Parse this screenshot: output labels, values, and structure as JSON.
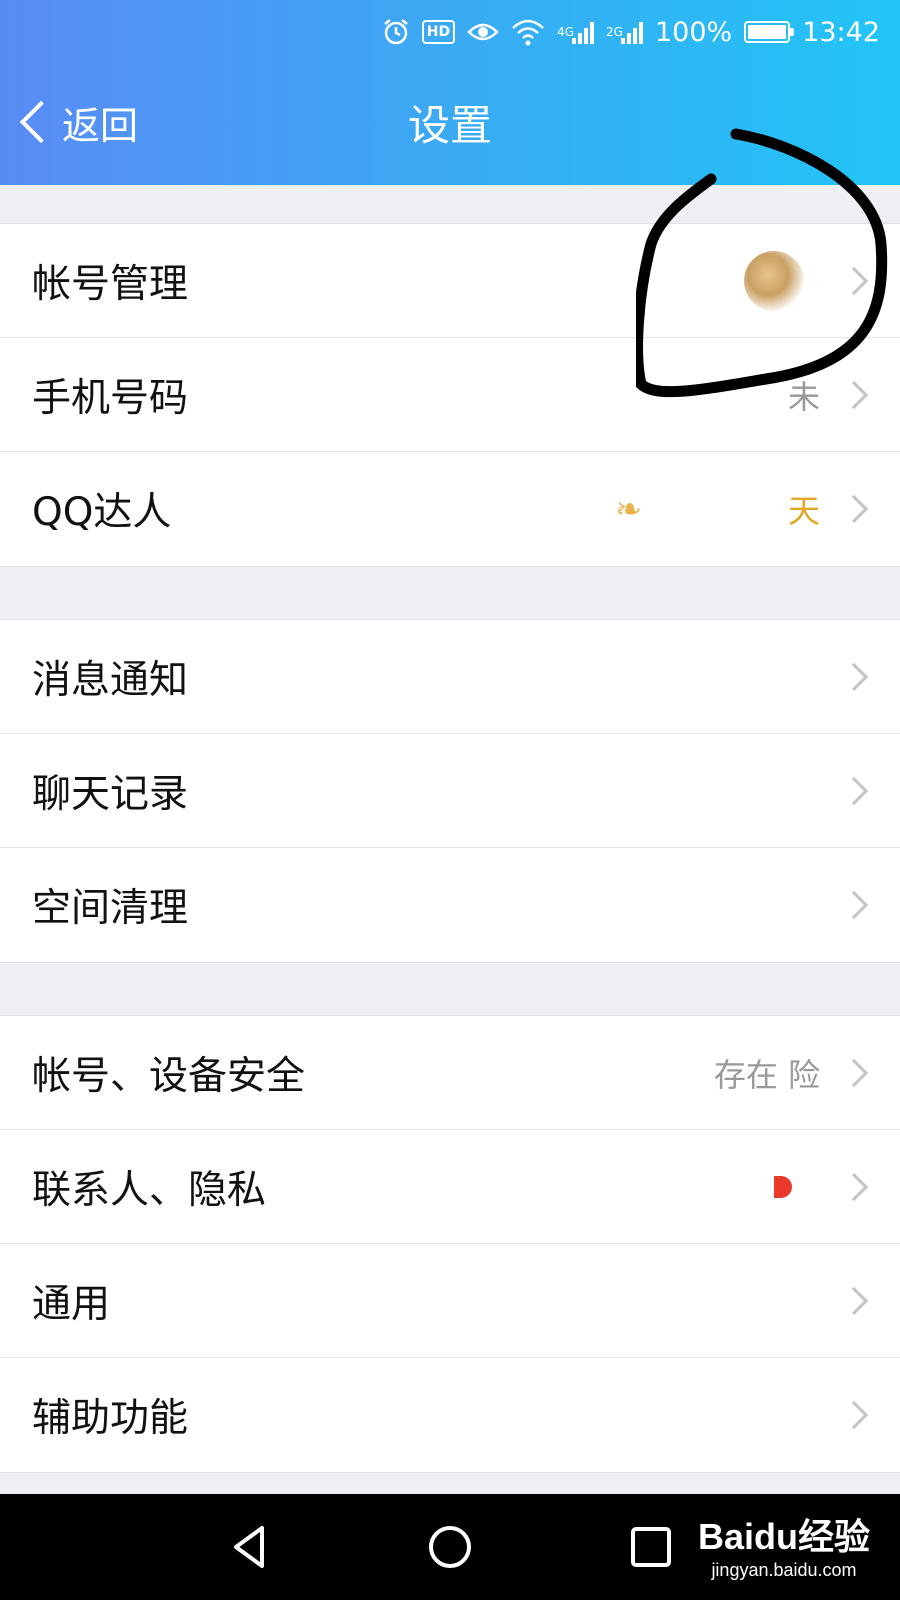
{
  "status_bar": {
    "hd": "HD",
    "net1": "4G",
    "net2": "2G",
    "battery": "100%",
    "time": "13:42"
  },
  "header": {
    "back_label": "返回",
    "title": "设置"
  },
  "groups": [
    {
      "rows": [
        {
          "label": "帐号管理",
          "value": ""
        },
        {
          "label": "手机号码",
          "value": "未"
        },
        {
          "label": "QQ达人",
          "value": "天"
        }
      ]
    },
    {
      "rows": [
        {
          "label": "消息通知",
          "value": ""
        },
        {
          "label": "聊天记录",
          "value": ""
        },
        {
          "label": "空间清理",
          "value": ""
        }
      ]
    },
    {
      "rows": [
        {
          "label": "帐号、设备安全",
          "value": "存在    险"
        },
        {
          "label": "联系人、隐私",
          "value": ""
        },
        {
          "label": "通用",
          "value": ""
        },
        {
          "label": "辅助功能",
          "value": ""
        }
      ]
    }
  ],
  "watermark": {
    "title": "Baidu经验",
    "url": "jingyan.baidu.com"
  },
  "icons": {
    "alarm": "alarm-icon",
    "eye": "eye-icon",
    "wifi": "wifi-icon",
    "back": "chevron-left-icon",
    "row_chevron": "chevron-right-icon",
    "nav_back": "triangle-back-icon",
    "nav_home": "circle-home-icon",
    "nav_recent": "square-recent-icon"
  },
  "colors": {
    "header_start": "#5a8bf5",
    "header_end": "#22c4f7",
    "gold": "#e3a626",
    "red_dot": "#ea3a2a"
  }
}
